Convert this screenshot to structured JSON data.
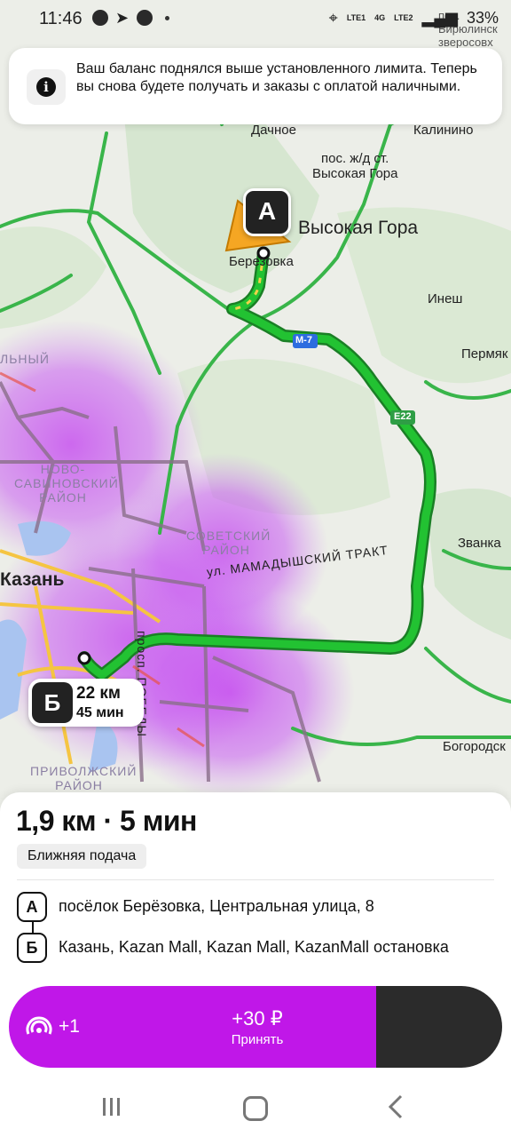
{
  "status": {
    "time": "11:46",
    "battery": "33%",
    "sim1": "LTE1",
    "sim2": "LTE2",
    "net": "4G"
  },
  "notice": {
    "text": "Ваш баланс поднялся выше установленного лимита. Теперь вы снова будете получать и заказы с оплатой наличными.",
    "icon": "info-icon"
  },
  "map": {
    "labels": {
      "dachnoe": "Дачное",
      "kalinino": "Калинино",
      "station": "пос. ж/д ст.",
      "station2": "Высокая Гора",
      "vysokaya_gora": "Высокая Гора",
      "berezovka": "Березовка",
      "inesh": "Инеш",
      "perm": "Пермяк",
      "zvanka": "Званка",
      "bogorodsk": "Богородск",
      "kazan": "Казань",
      "m7": "М-7",
      "e22": "E22",
      "trakt": "ул. МАМАДЫШСКИЙ ТРАКТ",
      "prosp": "просп. ПОБЕДЫ",
      "sovetsky": "СОВЕТСКИЙ РАЙОН",
      "novo": "НОВО-САВИНОВСКИЙ РАЙОН",
      "privolzh": "ПРИВОЛЖСКИЙ РАЙОН",
      "top_right": "пос. Бирюлинск зверосовх",
      "left_cut": "ЛЬНЫЙ"
    },
    "pin_a": "А",
    "pin_b": "Б",
    "route_km": "22 км",
    "route_min": "45 мин"
  },
  "order": {
    "summary": "1,9 км · 5 мин",
    "tag": "Ближняя подача",
    "from_badge": "А",
    "from": "посёлок Берёзовка, Центральная улица, 8",
    "to_badge": "Б",
    "to": "Казань, Kazan Mall, Kazan Mall, KazanMall остановка"
  },
  "accept": {
    "plus": "+1",
    "amount": "+30 ₽",
    "label": "Принять"
  },
  "colors": {
    "accent": "#c017e8",
    "route": "#1fb830",
    "dark": "#2b2b2b"
  }
}
